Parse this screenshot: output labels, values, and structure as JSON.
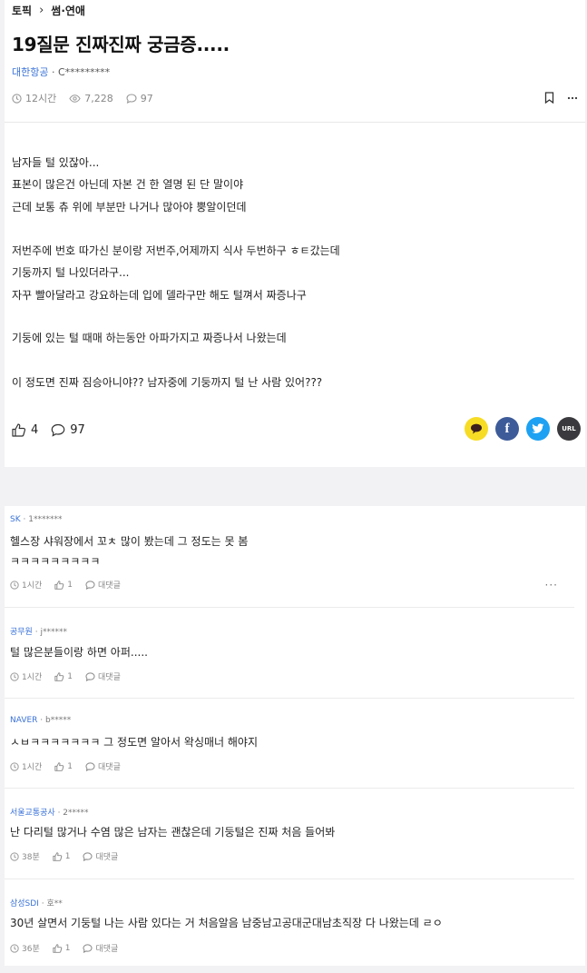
{
  "breadcrumb": {
    "root": "토픽",
    "current": "썸·연애"
  },
  "post": {
    "title": "19질문 진짜진짜 궁금증.....",
    "company": "대한항공",
    "author": "C*********",
    "time": "12시간",
    "views": "7,228",
    "comments": "97",
    "lines": [
      "남자들 털 있잖아...",
      "표본이 많은건 아닌데 자본 건 한 열명 된 단 말이야",
      "근데 보통 츄 위에 부분만 나거나 많아야 뿡알이던데",
      "저번주에 번호 따가신 분이랑 저번주,어제까지 식사 두번하구 ㅎㅌ갔는데",
      "기둥까지 털 나있더라구...",
      "자꾸 빨아달라고 강요하는데 입에 델라구만 해도 털껴서 짜증나구",
      "기둥에 있는 털 때매 하는동안 아파가지고 짜증나서 나왔는데",
      "이 정도면 진짜 짐승아니야?? 남자중에 기둥까지 털 난 사람 있어???"
    ],
    "likes": "4",
    "comment_count": "97"
  },
  "share": {
    "url_label": "URL"
  },
  "comments": [
    {
      "company": "SK",
      "author": "1*******",
      "text": "헬스장 샤워장에서 꼬ㅊ 많이 봤는데 그 정도는 못 봄",
      "text2": "ㅋㅋㅋㅋㅋㅋㅋㅋㅋ",
      "time": "1시간",
      "likes": "1",
      "reply": "대댓글"
    },
    {
      "company": "공무원",
      "author": "j******",
      "text": "털 많은분들이랑 하면 아퍼.....",
      "time": "1시간",
      "likes": "1",
      "reply": "대댓글"
    },
    {
      "company": "NAVER",
      "author": "b*****",
      "text": "ㅅㅂㅋㅋㅋㅋㅋㅋㅋ 그 정도면 알아서 왁싱매너 해야지",
      "time": "1시간",
      "likes": "1",
      "reply": "대댓글"
    },
    {
      "company": "서울교통공사",
      "author": "2*****",
      "text": "난 다리털 많거나 수염 많은 남자는 괜찮은데 기둥털은 진짜 처음 들어봐",
      "time": "38분",
      "likes": "1",
      "reply": "대댓글"
    },
    {
      "company": "삼성SDI",
      "author": "호**",
      "text": "30년 살면서 기둥털 나는 사람 있다는 거 처음알음 남중남고공대군대남초직장 다 나왔는데 ㄹㅇ",
      "time": "36분",
      "likes": "1",
      "reply": "대댓글"
    }
  ]
}
